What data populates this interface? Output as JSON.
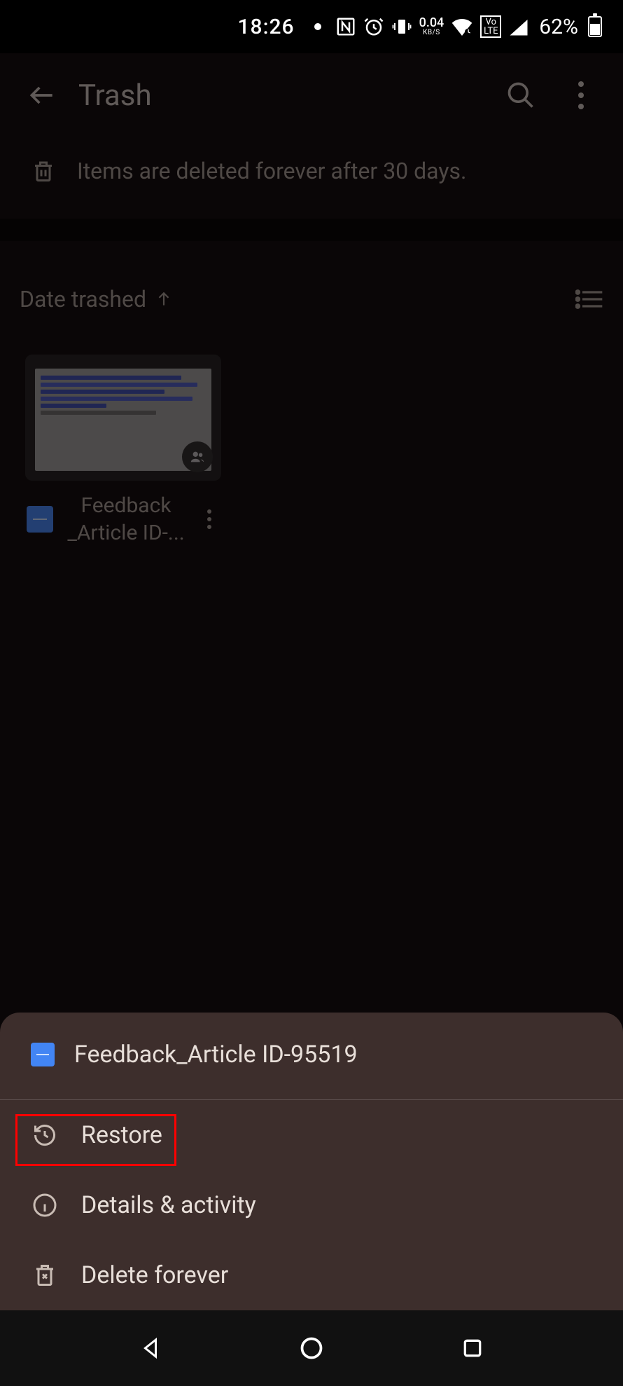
{
  "status": {
    "time": "18:26",
    "kbs_value": "0.04",
    "kbs_label": "KB/S",
    "volte": "Vo LTE",
    "battery_pct": "62%"
  },
  "appbar": {
    "title": "Trash"
  },
  "notice": {
    "text": "Items are deleted forever after 30 days."
  },
  "sort": {
    "label": "Date trashed"
  },
  "file": {
    "name_line1": "Feedback",
    "name_line2": "_Article ID-..."
  },
  "sheet": {
    "title": "Feedback_Article ID-95519",
    "items": {
      "restore": "Restore",
      "details": "Details & activity",
      "delete": "Delete forever"
    }
  }
}
